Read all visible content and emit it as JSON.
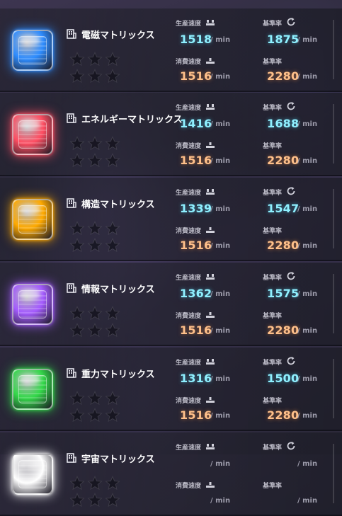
{
  "labels": {
    "production_rate": "生産速度",
    "base_rate": "基準率",
    "consumption_rate": "消費速度",
    "unit": "/ min"
  },
  "icons": {
    "production": "conveyor-out-icon",
    "base": "refresh-icon",
    "consumption": "conveyor-in-icon",
    "name_prefix": "building-doc-icon",
    "rating": "star-icon"
  },
  "matrices": [
    {
      "name": "電磁マトリックス",
      "color": "#2f8dff",
      "production": "1518",
      "base": "1875",
      "consumption": "1516",
      "base_consumption": "2280"
    },
    {
      "name": "エネルギーマトリックス",
      "color": "#ff4f63",
      "production": "1416",
      "base": "1688",
      "consumption": "1516",
      "base_consumption": "2280"
    },
    {
      "name": "構造マトリックス",
      "color": "#ffaa00",
      "production": "1339",
      "base": "1547",
      "consumption": "1516",
      "base_consumption": "2280"
    },
    {
      "name": "情報マトリックス",
      "color": "#a55cff",
      "production": "1362",
      "base": "1575",
      "consumption": "1516",
      "base_consumption": "2280"
    },
    {
      "name": "重力マトリックス",
      "color": "#34d94a",
      "production": "1316",
      "base": "1500",
      "consumption": "1516",
      "base_consumption": "2280"
    },
    {
      "name": "宇宙マトリックス",
      "color": "#ffffff"
    }
  ]
}
